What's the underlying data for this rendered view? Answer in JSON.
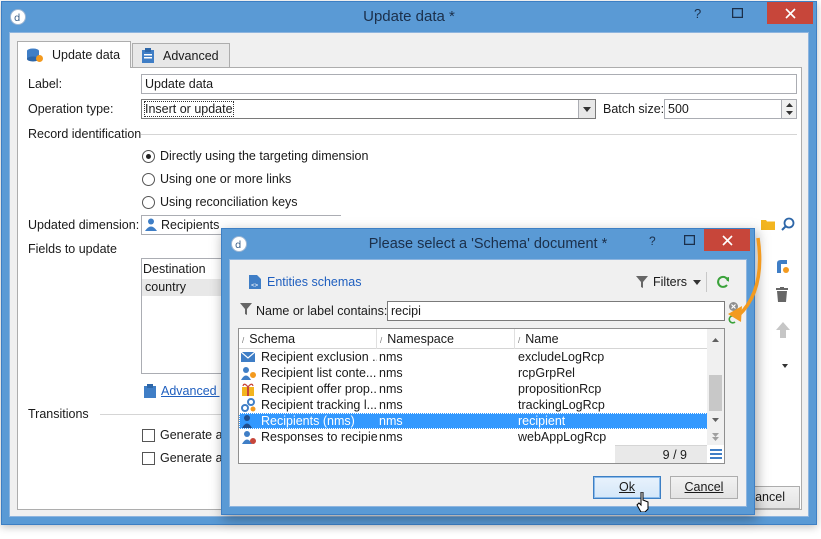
{
  "main": {
    "title": "Update data *",
    "tabs": [
      {
        "label": "Update data"
      },
      {
        "label": "Advanced"
      }
    ],
    "label_caption": "Label:",
    "label_value": "Update data",
    "operation_caption": "Operation type:",
    "operation_value": "Insert or update",
    "batch_caption": "Batch size:",
    "batch_value": "500",
    "record_id_caption": "Record identification",
    "radios": [
      {
        "label": "Directly using the targeting dimension",
        "checked": true
      },
      {
        "label": "Using one or more links",
        "checked": false
      },
      {
        "label": "Using reconciliation keys",
        "checked": false
      }
    ],
    "updated_dim_caption": "Updated dimension:",
    "updated_dim_value": "Recipients",
    "fields_caption": "Fields to update",
    "fields_header": "Destination",
    "fields_row": "country",
    "advanced_link": "Advanced p",
    "transitions_caption": "Transitions",
    "generate_1": "Generate an",
    "generate_2": "Generate an",
    "cancel_partial": "ancel"
  },
  "modal": {
    "title": "Please select a 'Schema' document *",
    "entities_label": "Entities schemas",
    "filters_label": "Filters",
    "search_caption": "Name or label contains:",
    "search_value": "recipi",
    "columns": [
      "Schema",
      "Namespace",
      "Name"
    ],
    "rows": [
      {
        "schema": "Recipient exclusion ...",
        "ns": "nms",
        "name": "excludeLogRcp",
        "icon": "envelope-exclusion-icon"
      },
      {
        "schema": "Recipient list conte...",
        "ns": "nms",
        "name": "rcpGrpRel",
        "icon": "recipient-list-icon"
      },
      {
        "schema": "Recipient offer prop...",
        "ns": "nms",
        "name": "propositionRcp",
        "icon": "offer-gift-icon"
      },
      {
        "schema": "Recipient tracking l...",
        "ns": "nms",
        "name": "trackingLogRcp",
        "icon": "tracking-link-icon"
      },
      {
        "schema": "Recipients (nms)",
        "ns": "nms",
        "name": "recipient",
        "icon": "recipient-icon",
        "selected": true
      },
      {
        "schema": "Responses to recipie...",
        "ns": "nms",
        "name": "webAppLogRcp",
        "icon": "web-response-icon"
      }
    ],
    "count": "9 / 9",
    "ok_label": "Ok",
    "cancel_label": "Cancel"
  },
  "colors": {
    "title_bar": "#5a9ad5",
    "close_button": "#c7463a",
    "selection": "#3399ff",
    "arrow": "#f39a1f",
    "link": "#1f5fbf"
  }
}
